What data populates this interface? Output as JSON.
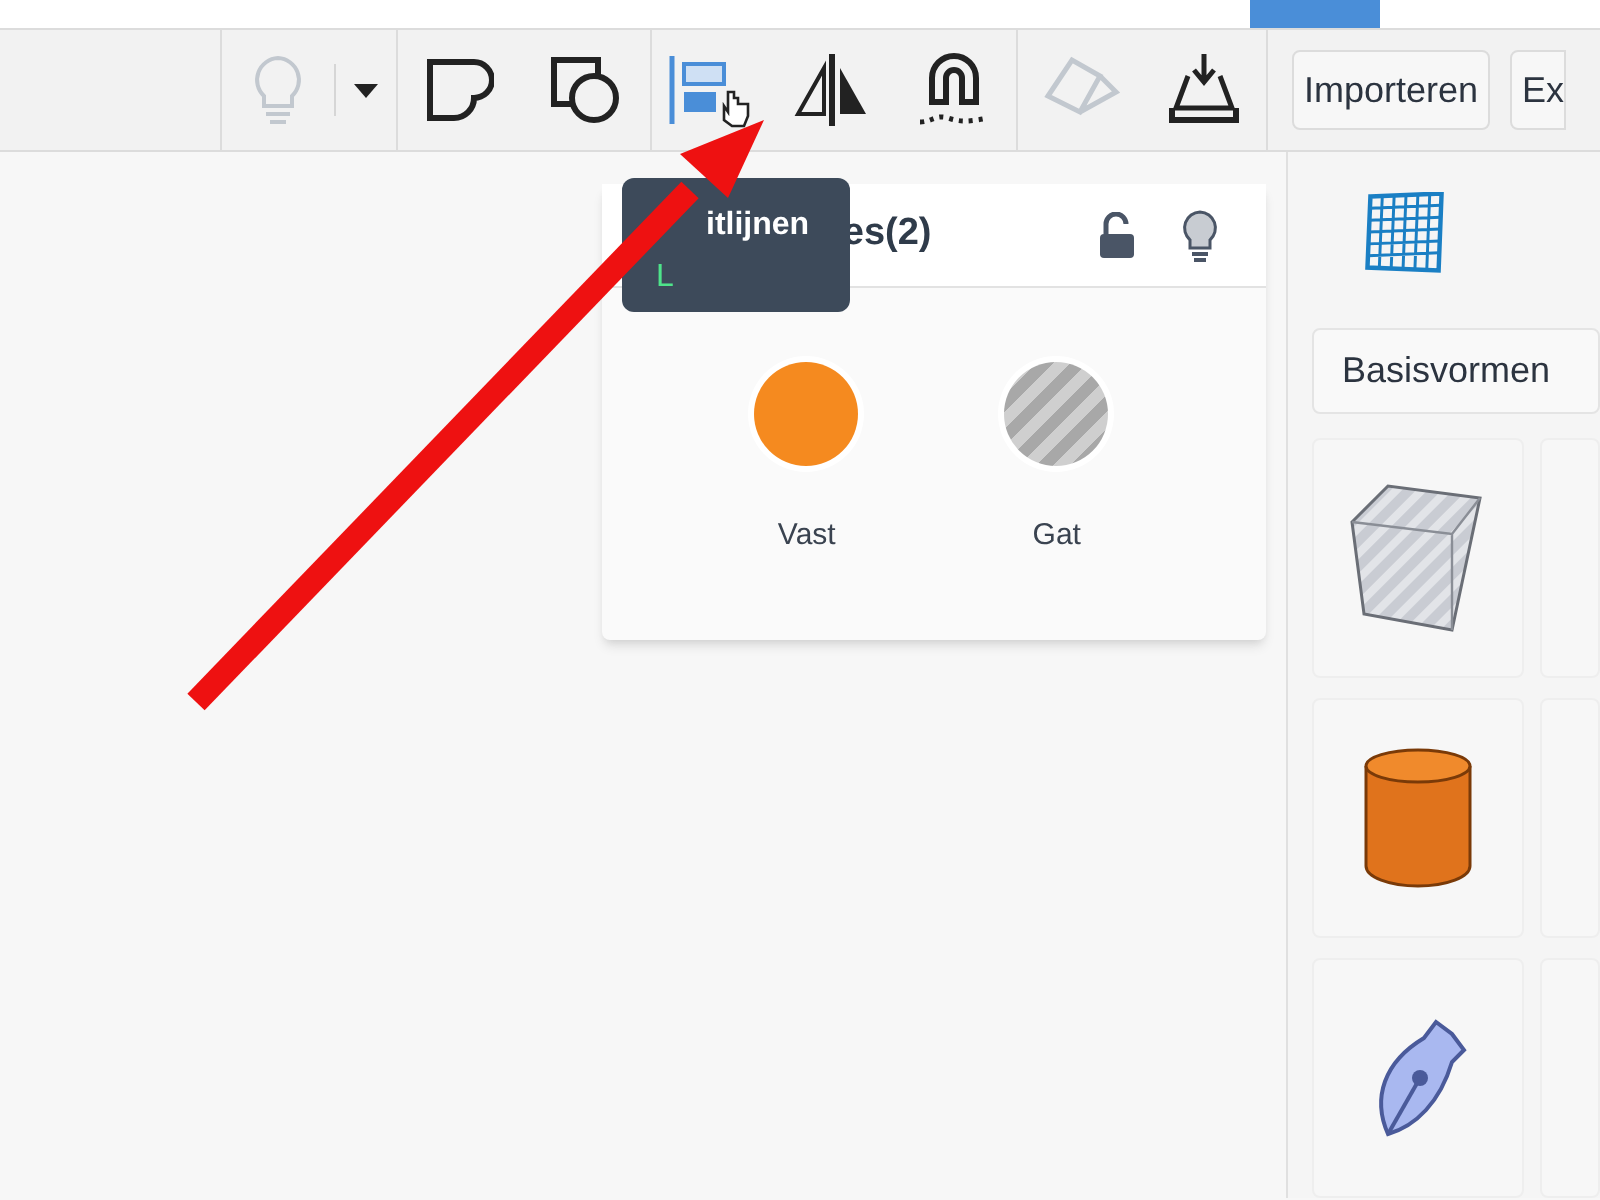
{
  "toolbar": {
    "tools": [
      {
        "kind": "bulb",
        "disabled": true
      },
      {
        "kind": "caret",
        "disabled": false
      },
      {
        "kind": "group",
        "disabled": false
      },
      {
        "kind": "ungroup",
        "disabled": false
      },
      {
        "kind": "align",
        "disabled": false
      },
      {
        "kind": "mirror",
        "disabled": false
      },
      {
        "kind": "magnet",
        "disabled": false
      },
      {
        "kind": "workplane",
        "disabled": true
      },
      {
        "kind": "drop",
        "disabled": false
      }
    ],
    "buttons": [
      "Importeren",
      "Ex"
    ]
  },
  "tooltip": {
    "title": "itlijnen",
    "shortcut": "L"
  },
  "shapes_panel": {
    "title": "es(2)",
    "options": [
      {
        "kind": "solid",
        "label": "Vast"
      },
      {
        "kind": "hole",
        "label": "Gat"
      }
    ]
  },
  "sidebar": {
    "category": "Basisvormen",
    "tiles": [
      {
        "kind": "box"
      },
      {
        "kind": "cylinder"
      },
      {
        "kind": "scribble"
      }
    ]
  }
}
